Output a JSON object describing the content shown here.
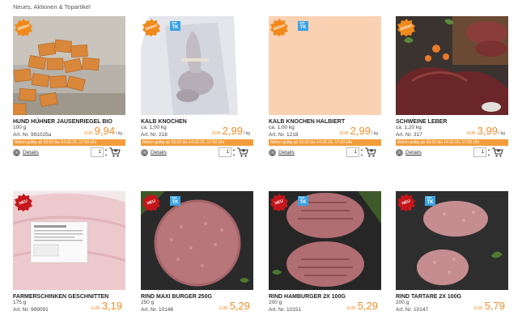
{
  "section_title": "Neues, Aktionen & Topartikel",
  "colors": {
    "accent": "#f28c28",
    "promo": "#f39c3a",
    "aktion_badge": "#f08a1c",
    "neu_badge": "#c4161c",
    "tk_badge": "#3aa3e3"
  },
  "labels": {
    "details": "Details",
    "tk": "TK"
  },
  "products": [
    {
      "name": "HUND HÜHNER JAUSENRIEGEL BIO",
      "weight": "100 g",
      "art_nr": "Art. Nr. 991025a",
      "currency": "EUR",
      "price": "9,94",
      "unit": "/ kg",
      "badge": "Aktion",
      "tk": false,
      "promo": "Aktion gültig ab 03.02 bis 14.02.26, 17:00 Uhr",
      "qty": "1",
      "image": "treats"
    },
    {
      "name": "KALB KNOCHEN",
      "weight": "ca. 1,00 kg",
      "art_nr": "Art. Nr. 218",
      "currency": "EUR",
      "price": "2,99",
      "unit": "/ kg",
      "badge": "Aktion",
      "tk": true,
      "promo": "Aktion gültig ab 03.02 bis 14.02.26, 17:00 Uhr",
      "qty": "1",
      "image": "bone"
    },
    {
      "name": "KALB KNOCHEN HALBIERT",
      "weight": "ca. 1,00 kg",
      "art_nr": "Art. Nr. 1218",
      "currency": "EUR",
      "price": "2,99",
      "unit": "/ kg",
      "badge": "Aktion",
      "tk": true,
      "promo": "Aktion gültig ab 03.02 bis 14.02.26, 17:00 Uhr",
      "qty": "1",
      "image": "blank"
    },
    {
      "name": "SCHWEINE LEBER",
      "weight": "ca. 1,20 kg",
      "art_nr": "Art. Nr. 317",
      "currency": "EUR",
      "price": "3,99",
      "unit": "/ kg",
      "badge": "Aktion",
      "tk": false,
      "promo": "Aktion gültig ab 03.02 bis 14.02.26, 17:00 Uhr",
      "qty": "1",
      "image": "liver"
    },
    {
      "name": "FARMERSCHINKEN GESCHNITTEN",
      "weight": "175 g",
      "art_nr": "Art. Nr. 999091",
      "currency": "EUR",
      "price": "3,19",
      "unit": "",
      "badge": "NEU",
      "tk": false,
      "promo": "",
      "qty": "",
      "image": "ham"
    },
    {
      "name": "RIND MAXI BURGER 250G",
      "weight": "250 g",
      "art_nr": "Art. Nr. 10146",
      "currency": "EUR",
      "price": "5,29",
      "unit": "",
      "badge": "NEU",
      "tk": true,
      "promo": "",
      "qty": "",
      "image": "burger1"
    },
    {
      "name": "RIND HAMBURGER 2X 100G",
      "weight": "200 g",
      "art_nr": "Art. Nr. 10151",
      "currency": "EUR",
      "price": "5,29",
      "unit": "",
      "badge": "NEU",
      "tk": true,
      "promo": "",
      "qty": "",
      "image": "burger2"
    },
    {
      "name": "RIND TARTARE 2X 100G",
      "weight": "200 g",
      "art_nr": "Art. Nr. 10147",
      "currency": "EUR",
      "price": "5,79",
      "unit": "",
      "badge": "NEU",
      "tk": true,
      "promo": "",
      "qty": "",
      "image": "tartare"
    }
  ]
}
